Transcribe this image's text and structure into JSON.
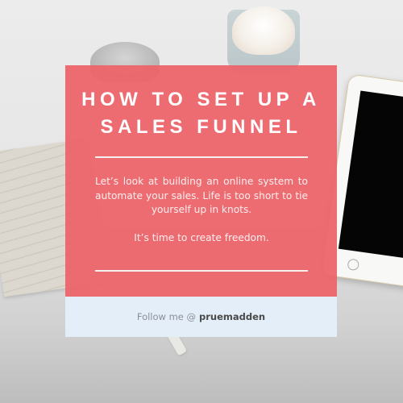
{
  "card": {
    "title_line_1": "HOW TO SET UP A",
    "title_line_2": "SALES FUNNEL",
    "body_paragraph_1": "Let’s look at building an online system to automate your sales.  Life is too short to tie yourself up in knots.",
    "body_paragraph_2": "It’s time to create freedom.",
    "footer": {
      "follow_text": "Follow me @",
      "handle": "pruemadden"
    }
  },
  "colors": {
    "panel_accent": "#ec646a",
    "footer_background": "#e4eef8",
    "title_text": "#ffffff",
    "handle_text": "#4a4a4a"
  }
}
